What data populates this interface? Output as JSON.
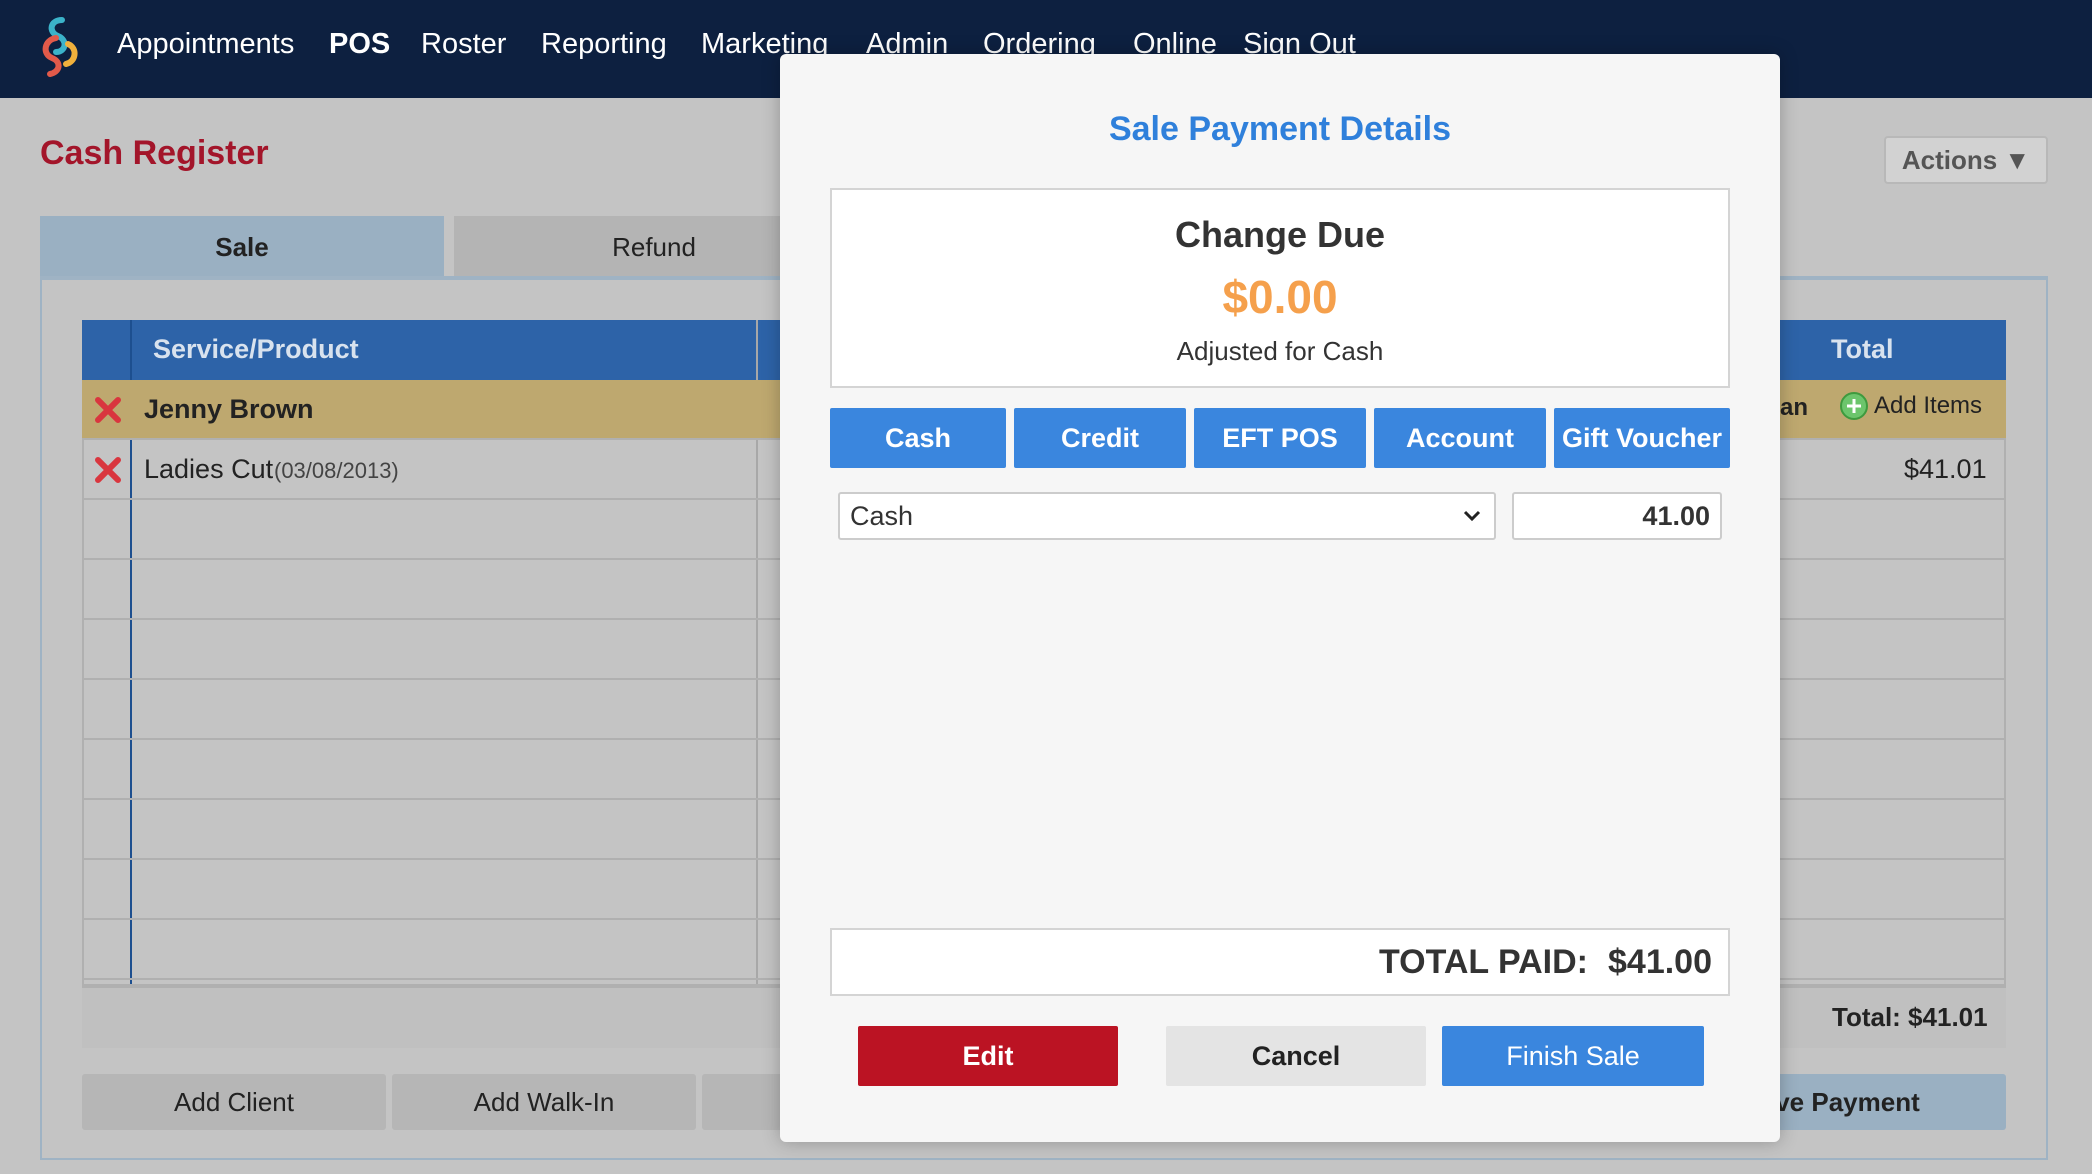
{
  "nav": {
    "items": [
      "Appointments",
      "POS",
      "Roster",
      "Reporting",
      "Marketing",
      "Admin",
      "Ordering",
      "Online",
      "Sign Out"
    ]
  },
  "page": {
    "title": "Cash Register",
    "actions_label": "Actions ▼",
    "tabs": [
      "Sale",
      "Refund"
    ]
  },
  "grid": {
    "col_service": "Service/Product",
    "col_total": "Total",
    "client_name": "Jenny Brown",
    "client_partial": "an",
    "add_items_label": "Add Items",
    "items": [
      {
        "name": "Ladies Cut",
        "date": "(03/08/2013)",
        "total": "$41.01"
      }
    ],
    "grand_total": "Total: $41.01"
  },
  "bottom_buttons": {
    "add_client": "Add Client",
    "add_walk_in": "Add Walk-In",
    "receive_payment": "ive Payment"
  },
  "modal": {
    "title": "Sale Payment Details",
    "change_label": "Change Due",
    "change_amount": "$0.00",
    "change_note": "Adjusted for Cash",
    "payment_methods": [
      "Cash",
      "Credit",
      "EFT POS",
      "Account",
      "Gift Voucher"
    ],
    "selected_method": "Cash",
    "amount_value": "41.00",
    "total_paid_label": "TOTAL PAID:",
    "total_paid_value": "$41.00",
    "edit_label": "Edit",
    "cancel_label": "Cancel",
    "finish_label": "Finish Sale"
  },
  "colors": {
    "nav_bg": "#0d2040",
    "title_red": "#a3152a",
    "accent_blue": "#3a86de",
    "change_orange": "#f5a04c",
    "edit_red": "#bb1323"
  }
}
